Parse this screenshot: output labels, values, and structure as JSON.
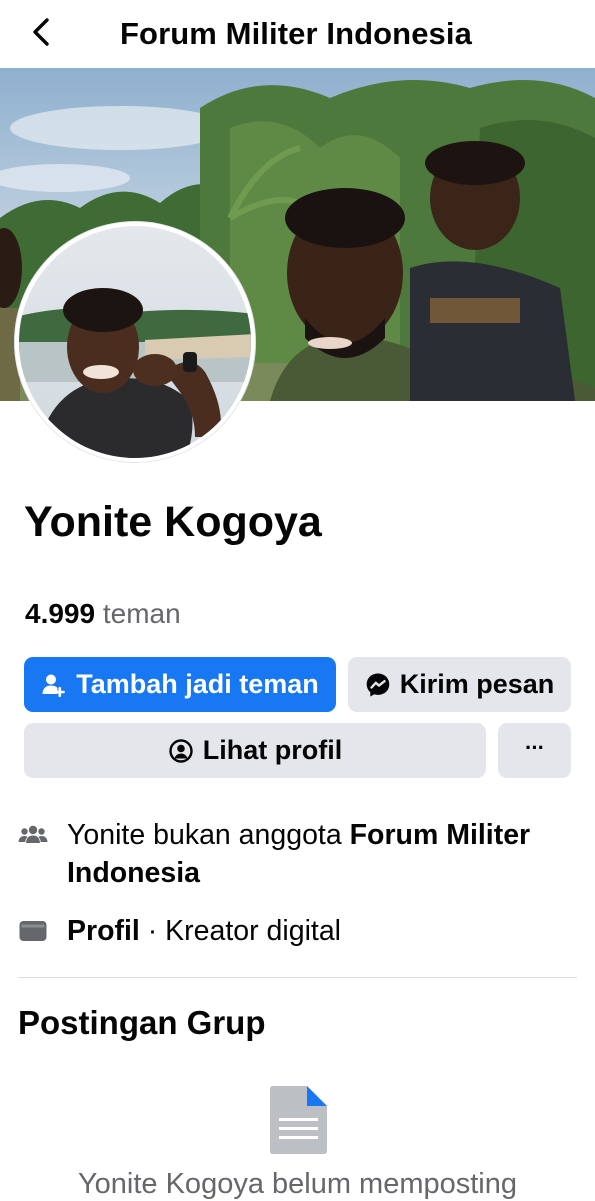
{
  "header": {
    "title": "Forum Militer Indonesia",
    "back_icon": "chevron-left-icon"
  },
  "profile": {
    "name": "Yonite Kogoya",
    "friends_count": "4.999",
    "friends_label": "teman"
  },
  "actions": {
    "add_friend_label": "Tambah jadi teman",
    "add_friend_icon": "person-add-icon",
    "message_label": "Kirim pesan",
    "message_icon": "messenger-icon",
    "view_profile_label": "Lihat profil",
    "view_profile_icon": "user-circle-icon",
    "more_label": "···"
  },
  "info": {
    "membership_prefix": "Yonite bukan anggota ",
    "membership_group": "Forum Militer Indonesia",
    "membership_icon": "people-icon",
    "profile_bold": "Profil",
    "profile_rest": " · Kreator digital",
    "profile_icon": "flag-card-icon"
  },
  "posts": {
    "section_title": "Postingan Grup",
    "empty_text": "Yonite Kogoya belum memposting",
    "empty_icon": "document-icon"
  },
  "colors": {
    "primary": "#1877f2",
    "secondary_bg": "#e4e6eb",
    "text": "#050505",
    "muted": "#65676b"
  }
}
